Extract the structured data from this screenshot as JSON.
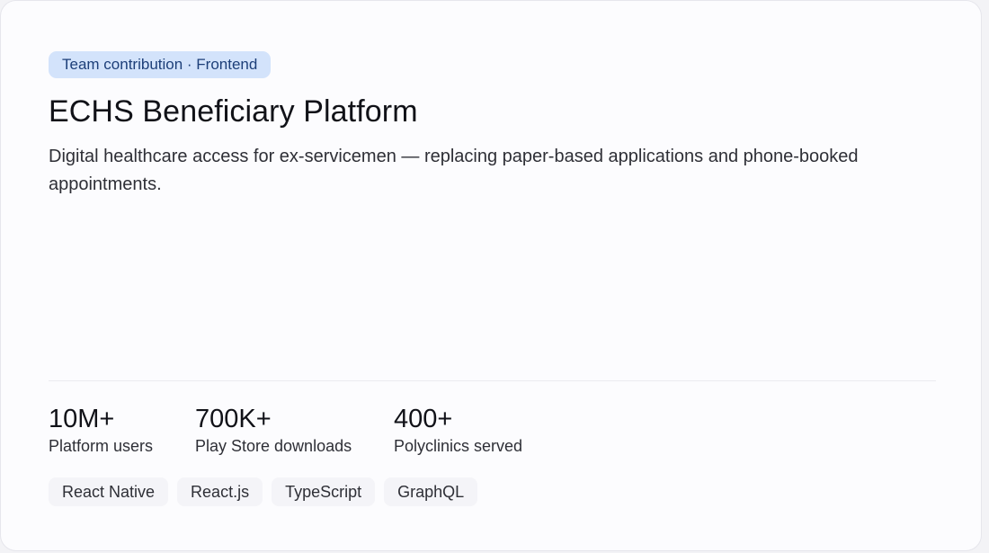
{
  "card": {
    "badge": "Team contribution · Frontend",
    "title": "ECHS Beneficiary Platform",
    "description": "Digital healthcare access for ex-servicemen — replacing paper-based applications and phone-booked appointments."
  },
  "stats": [
    {
      "value": "10M+",
      "label": "Platform users"
    },
    {
      "value": "700K+",
      "label": "Play Store downloads"
    },
    {
      "value": "400+",
      "label": "Polyclinics served"
    }
  ],
  "tags": [
    "React Native",
    "React.js",
    "TypeScript",
    "GraphQL"
  ],
  "colors": {
    "badge_bg": "#d3e3fb",
    "badge_text": "#1d3f79",
    "card_bg": "#fcfcfe",
    "title_text": "#111218"
  }
}
